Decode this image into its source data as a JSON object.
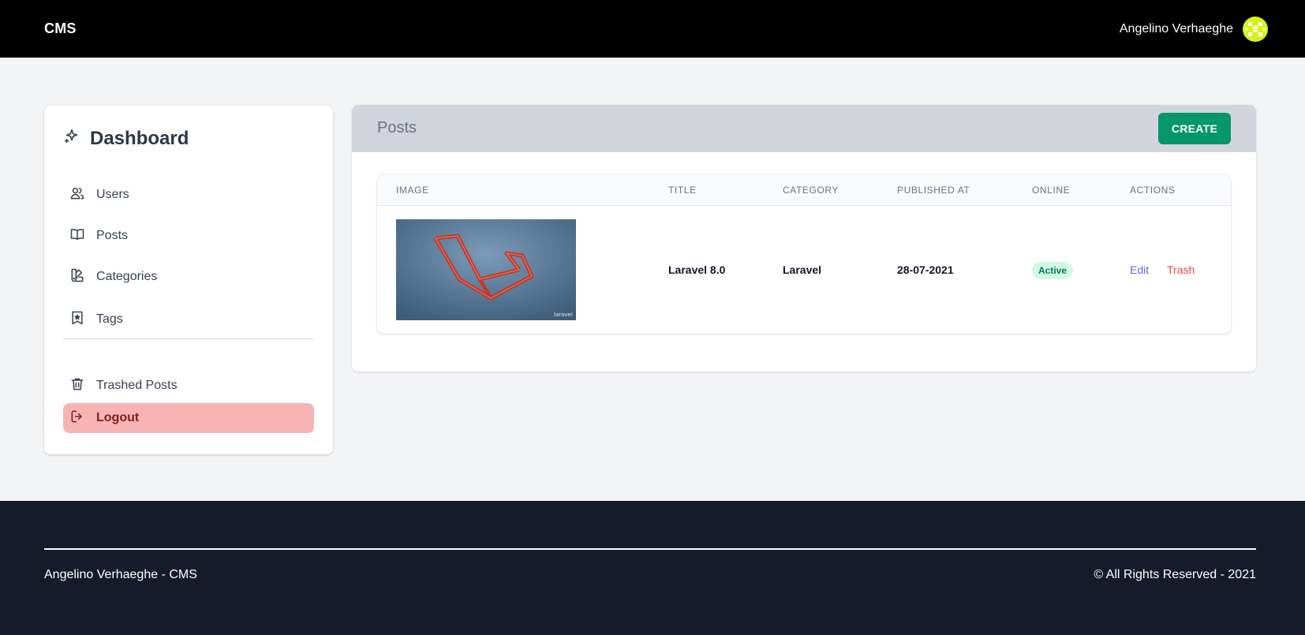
{
  "topbar": {
    "brand": "CMS",
    "user_name": "Angelino Verhaeghe",
    "avatar_color": "#d6f21a"
  },
  "sidebar": {
    "title": "Dashboard",
    "title_icon": "sparkles-icon",
    "items": [
      {
        "label": "Users",
        "icon": "users-icon"
      },
      {
        "label": "Posts",
        "icon": "book-icon"
      },
      {
        "label": "Categories",
        "icon": "color-swatch-icon"
      },
      {
        "label": "Tags",
        "icon": "bookmark-star-icon"
      }
    ],
    "trashed": {
      "label": "Trashed Posts",
      "icon": "trash-icon"
    },
    "logout": {
      "label": "Logout",
      "icon": "logout-icon",
      "bg_color": "#f8b4b4"
    }
  },
  "main": {
    "title": "Posts",
    "create_label": "CREATE",
    "create_color": "#059669",
    "table": {
      "headers": [
        "IMAGE",
        "TITLE",
        "CATEGORY",
        "PUBLISHED AT",
        "ONLINE",
        "ACTIONS"
      ],
      "rows": [
        {
          "image_watermark": "laravel",
          "title": "Laravel 8.0",
          "category": "Laravel",
          "published_at": "28-07-2021",
          "online": "Active",
          "edit_label": "Edit",
          "trash_label": "Trash"
        }
      ]
    }
  },
  "footer": {
    "left": "Angelino Verhaeghe - CMS",
    "right": "© All Rights Reserved - 2021",
    "bg_color": "#161b2b"
  }
}
